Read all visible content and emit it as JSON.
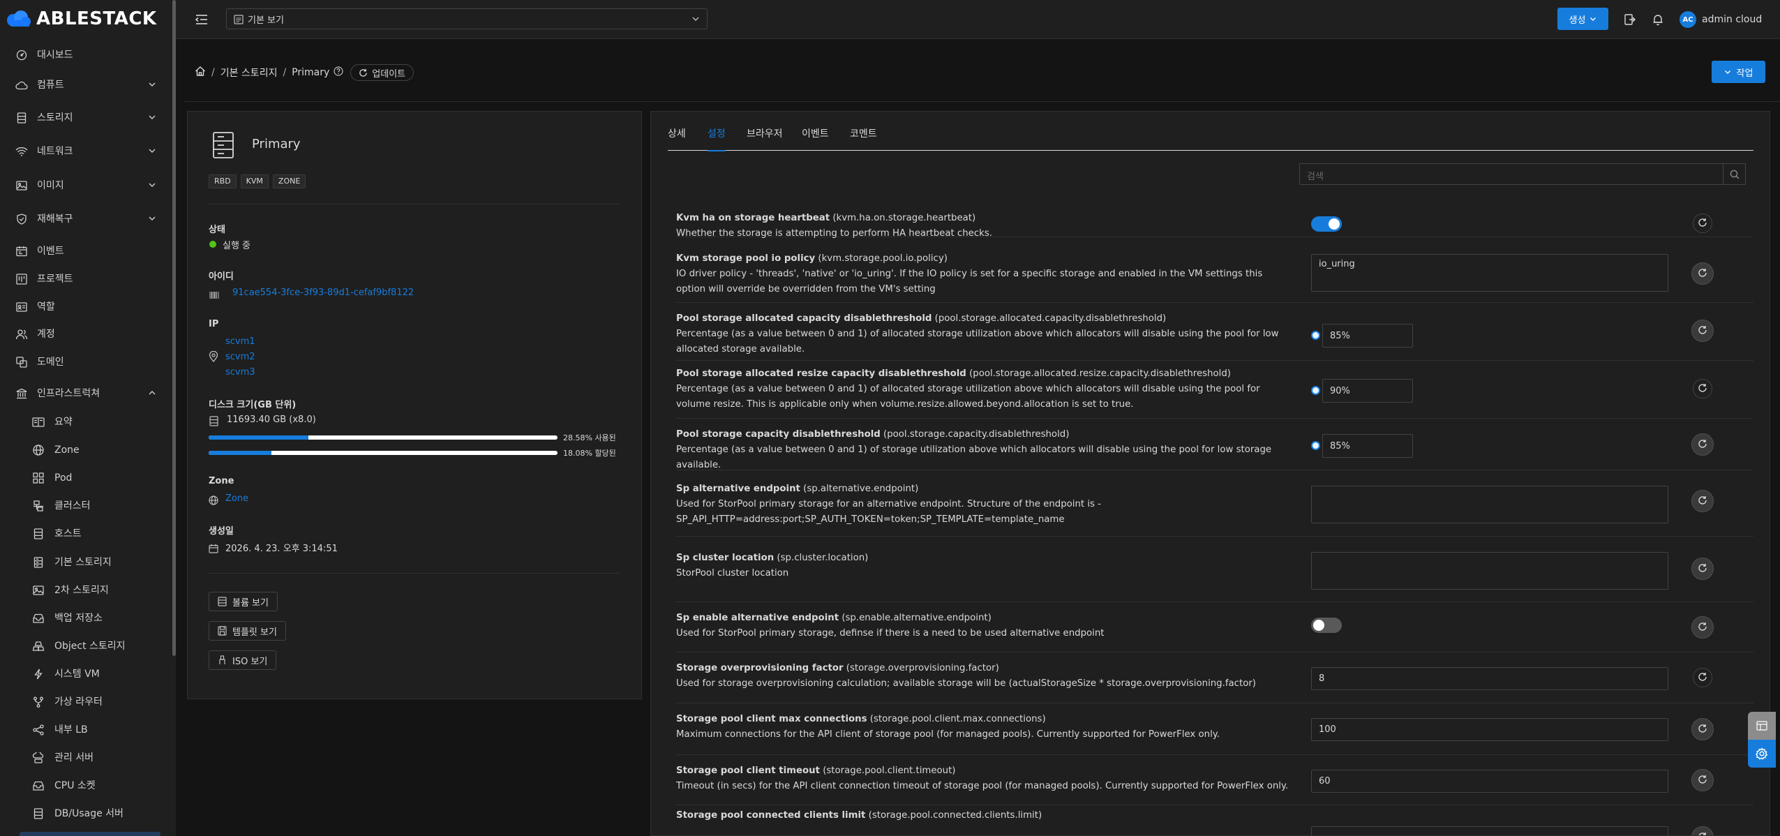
{
  "brand": {
    "name": "ABLESTACK"
  },
  "sidebar": {
    "items": [
      {
        "label": "대시보드",
        "icon": "dashboard-icon",
        "expandable": false
      },
      {
        "label": "컴퓨트",
        "icon": "cloud-icon",
        "expandable": true
      },
      {
        "label": "스토리지",
        "icon": "database-icon",
        "expandable": true
      },
      {
        "label": "네트워크",
        "icon": "wifi-icon",
        "expandable": true
      },
      {
        "label": "이미지",
        "icon": "picture-icon",
        "expandable": true
      },
      {
        "label": "재해복구",
        "icon": "shield-icon",
        "expandable": true
      },
      {
        "label": "이벤트",
        "icon": "schedule-icon",
        "expandable": false
      },
      {
        "label": "프로젝트",
        "icon": "project-icon",
        "expandable": false
      },
      {
        "label": "역할",
        "icon": "idcard-icon",
        "expandable": false
      },
      {
        "label": "계정",
        "icon": "team-icon",
        "expandable": false
      },
      {
        "label": "도메인",
        "icon": "block-icon",
        "expandable": false
      },
      {
        "label": "인프라스트럭쳐",
        "icon": "bank-icon",
        "expandable": true,
        "expanded": true
      }
    ],
    "subitems": [
      {
        "label": "요약",
        "icon": "read-icon"
      },
      {
        "label": "Zone",
        "icon": "global-icon"
      },
      {
        "label": "Pod",
        "icon": "appstore-icon"
      },
      {
        "label": "클러스터",
        "icon": "cluster-icon"
      },
      {
        "label": "호스트",
        "icon": "host-icon"
      },
      {
        "label": "기본 스토리지",
        "icon": "storage-icon"
      },
      {
        "label": "2차 스토리지",
        "icon": "picture-icon"
      },
      {
        "label": "백업 저장소",
        "icon": "inbox-icon"
      },
      {
        "label": "Object 스토리지",
        "icon": "gold-icon"
      },
      {
        "label": "시스템 VM",
        "icon": "thunderbolt-icon"
      },
      {
        "label": "가상 라우터",
        "icon": "fork-icon"
      },
      {
        "label": "내부 LB",
        "icon": "share-icon"
      },
      {
        "label": "관리 서버",
        "icon": "cloud-server-icon"
      },
      {
        "label": "CPU 소켓",
        "icon": "inbox-icon"
      },
      {
        "label": "DB/Usage 서버",
        "icon": "database-icon"
      }
    ]
  },
  "topbar": {
    "view_select": "기본 보기",
    "create_label": "생성",
    "user_initials": "AC",
    "user_name": "admin cloud"
  },
  "breadcrumb": {
    "items": [
      "기본 스토리지",
      "Primary"
    ],
    "refresh_label": "업데이트"
  },
  "action_label": "작업",
  "resource": {
    "name": "Primary",
    "tags": [
      "RBD",
      "KVM",
      "ZONE"
    ],
    "status_label": "상태",
    "status_value": "실행 중",
    "status_color": "#52c41a",
    "id_label": "아이디",
    "id_value": "91cae554-3fce-3f93-89d1-cefaf9bf8122",
    "ip_label": "IP",
    "ips": [
      "scvm1",
      "scvm2",
      "scvm3"
    ],
    "disk_label": "디스크 크기(GB 단위)",
    "disk_value": "11693.40 GB (x8.0)",
    "usage": [
      {
        "percent": 28.58,
        "text": "28.58% 사용된"
      },
      {
        "percent": 18.08,
        "text": "18.08% 할당된"
      }
    ],
    "zone_label": "Zone",
    "zone_value": "Zone",
    "created_label": "생성일",
    "created_value": "2026. 4. 23. 오후 3:14:51",
    "buttons": [
      "볼륨 보기",
      "템플릿 보기",
      "ISO 보기"
    ]
  },
  "tabs": [
    "상세",
    "설정",
    "브라우저",
    "이벤트",
    "코멘트"
  ],
  "active_tab": "설정",
  "search_placeholder": "검색",
  "settings": [
    {
      "title": "Kvm ha on storage heartbeat",
      "key": "(kvm.ha.on.storage.heartbeat)",
      "desc": "Whether the storage is attempting to perform HA heartbeat checks.",
      "type": "toggle",
      "value": true
    },
    {
      "title": "Kvm storage pool io policy",
      "key": "(kvm.storage.pool.io.policy)",
      "desc": "IO driver policy - 'threads', 'native' or 'io_uring'. If the IO policy is set for a specific storage and enabled in the VM settings this option will override be overridden from the VM's setting",
      "type": "textarea",
      "value": "io_uring"
    },
    {
      "title": "Pool storage allocated capacity disablethreshold",
      "key": "(pool.storage.allocated.capacity.disablethreshold)",
      "desc": "Percentage (as a value between 0 and 1) of allocated storage utilization above which allocators will disable using the pool for low allocated storage available.",
      "type": "percent",
      "value": "85%"
    },
    {
      "title": "Pool storage allocated resize capacity disablethreshold",
      "key": "(pool.storage.allocated.resize.capacity.disablethreshold)",
      "desc": "Percentage (as a value between 0 and 1) of allocated storage utilization above which allocators will disable using the pool for volume resize. This is applicable only when volume.resize.allowed.beyond.allocation is set to true.",
      "type": "percent",
      "value": "90%"
    },
    {
      "title": "Pool storage capacity disablethreshold",
      "key": "(pool.storage.capacity.disablethreshold)",
      "desc": "Percentage (as a value between 0 and 1) of storage utilization above which allocators will disable using the pool for low storage available.",
      "type": "percent",
      "value": "85%"
    },
    {
      "title": "Sp alternative endpoint",
      "key": "(sp.alternative.endpoint)",
      "desc": "Used for StorPool primary storage for an alternative endpoint. Structure of the endpoint is - SP_API_HTTP=address:port;SP_AUTH_TOKEN=token;SP_TEMPLATE=template_name",
      "type": "textarea",
      "value": ""
    },
    {
      "title": "Sp cluster location",
      "key": "(sp.cluster.location)",
      "desc": "StorPool cluster location",
      "type": "textarea",
      "value": ""
    },
    {
      "title": "Sp enable alternative endpoint",
      "key": "(sp.enable.alternative.endpoint)",
      "desc": "Used for StorPool primary storage, definse if there is a need to be used alternative endpoint",
      "type": "toggle",
      "value": false
    },
    {
      "title": "Storage overprovisioning factor",
      "key": "(storage.overprovisioning.factor)",
      "desc": "Used for storage overprovisioning calculation; available storage will be (actualStorageSize * storage.overprovisioning.factor)",
      "type": "input",
      "value": "8"
    },
    {
      "title": "Storage pool client max connections",
      "key": "(storage.pool.client.max.connections)",
      "desc": "Maximum connections for the API client of storage pool (for managed pools). Currently supported for PowerFlex only.",
      "type": "input",
      "value": "100"
    },
    {
      "title": "Storage pool client timeout",
      "key": "(storage.pool.client.timeout)",
      "desc": "Timeout (in secs) for the API client connection timeout of storage pool (for managed pools). Currently supported for PowerFlex only.",
      "type": "input",
      "value": "60"
    },
    {
      "title": "Storage pool connected clients limit",
      "key": "(storage.pool.connected.clients.limit)",
      "desc": "",
      "type": "input",
      "value": ""
    }
  ]
}
